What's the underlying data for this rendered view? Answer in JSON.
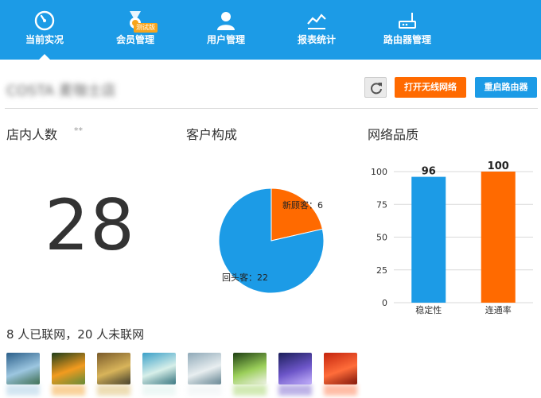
{
  "nav": {
    "items": [
      {
        "label": "当前实况",
        "icon": "speedometer-icon",
        "active": true
      },
      {
        "label": "会员管理",
        "icon": "medal-icon",
        "badge": "测试版"
      },
      {
        "label": "用户管理",
        "icon": "user-icon"
      },
      {
        "label": "报表统计",
        "icon": "line-chart-icon"
      },
      {
        "label": "路由器管理",
        "icon": "router-icon"
      }
    ]
  },
  "header": {
    "store_name": "COSTA 麦咖士店",
    "open_wifi_label": "打开无线网络",
    "reboot_label": "重启路由器",
    "refresh_icon": "refresh-icon"
  },
  "visitors": {
    "title": "店内人数",
    "marker": "**",
    "count": "28"
  },
  "composition": {
    "title": "客户构成"
  },
  "quality": {
    "title": "网络品质"
  },
  "online": {
    "summary": "8 人已联网，20 人未联网"
  },
  "chart_data": [
    {
      "type": "pie",
      "title": "客户构成",
      "slices": [
        {
          "label": "新顾客",
          "value": 6,
          "color": "#ff6a00"
        },
        {
          "label": "回头客",
          "value": 22,
          "color": "#1c9be6"
        }
      ]
    },
    {
      "type": "bar",
      "title": "网络品质",
      "categories": [
        "稳定性",
        "连通率"
      ],
      "values": [
        96,
        100
      ],
      "colors": [
        "#1c9be6",
        "#ff6a00"
      ],
      "ylim": [
        0,
        100
      ],
      "yticks": [
        0,
        25,
        50,
        75,
        100
      ],
      "grid": true
    }
  ],
  "devices": [
    {
      "colors": [
        "#2b5f8a",
        "#9cc6e0",
        "#3a6a4a"
      ]
    },
    {
      "colors": [
        "#1d3d1a",
        "#f29b1f",
        "#5a8a3a"
      ]
    },
    {
      "colors": [
        "#7a5b2a",
        "#d8b45a",
        "#3d3a2a"
      ]
    },
    {
      "colors": [
        "#3aa0c8",
        "#d7efe9",
        "#2f6f7a"
      ]
    },
    {
      "colors": [
        "#8fa9b8",
        "#e8eef0",
        "#5e7f8d"
      ]
    },
    {
      "colors": [
        "#1e3f12",
        "#9bcf5a",
        "#f4f4f0"
      ]
    },
    {
      "colors": [
        "#1b1e5a",
        "#6d56c9",
        "#c9b7ff"
      ]
    },
    {
      "colors": [
        "#c4240d",
        "#ff6d3a",
        "#7a1208"
      ]
    }
  ]
}
